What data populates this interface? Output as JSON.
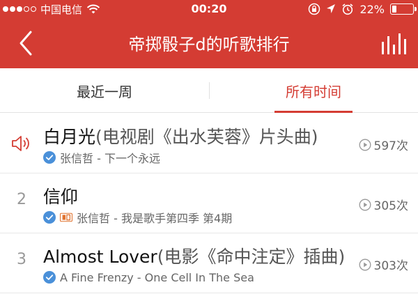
{
  "status_bar": {
    "carrier": "中国电信",
    "time": "00:20",
    "battery_percent": "22%",
    "battery_level": 0.22
  },
  "nav": {
    "title": "帝掷骰子d的听歌排行"
  },
  "tabs": [
    {
      "label": "最近一周",
      "selected": false
    },
    {
      "label": "所有时间",
      "selected": true
    }
  ],
  "songs": [
    {
      "rank": "",
      "now_playing": true,
      "title": "白月光",
      "subtitle": "(电视剧《出水芙蓉》片头曲)",
      "meta": "张信哲 - 下一个永远",
      "sq": false,
      "plays": "597次"
    },
    {
      "rank": "2",
      "now_playing": false,
      "title": "信仰",
      "subtitle": "",
      "meta": "张信哲 - 我是歌手第四季 第4期",
      "sq": true,
      "plays": "305次"
    },
    {
      "rank": "3",
      "now_playing": false,
      "title": "Almost Lover",
      "subtitle": "(电影《命中注定》插曲)",
      "meta": "A Fine Frenzy - One Cell In The Sea",
      "sq": false,
      "plays": "303次"
    }
  ],
  "colors": {
    "accent": "#d43c33",
    "verified": "#4a90d9"
  },
  "icons": [
    "back-arrow-icon",
    "bar-chart-icon",
    "speaker-icon",
    "verified-check-icon",
    "sq-badge-icon",
    "play-count-icon",
    "wifi-icon",
    "lock-rotation-icon",
    "location-icon",
    "alarm-icon",
    "battery-icon"
  ]
}
